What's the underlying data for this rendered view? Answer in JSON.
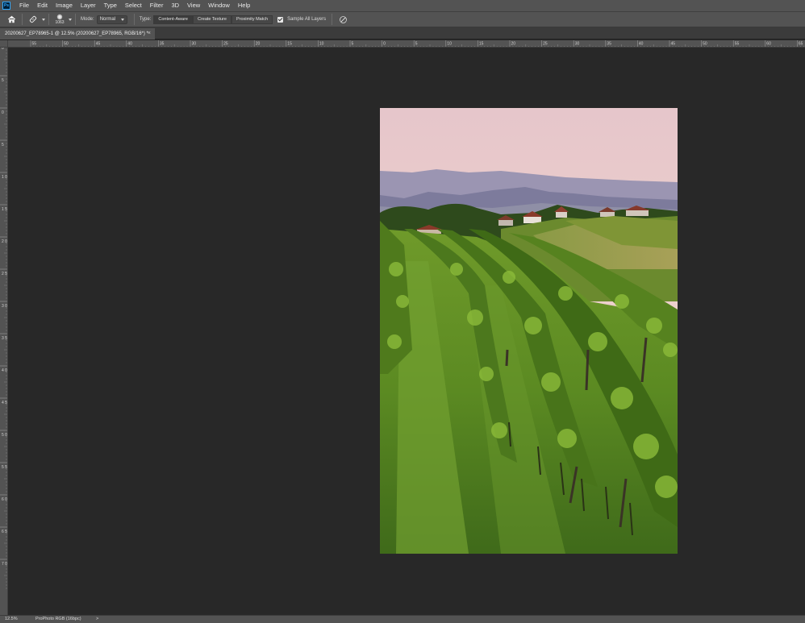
{
  "app": {
    "logo_text": "Ps"
  },
  "menu": [
    "File",
    "Edit",
    "Image",
    "Layer",
    "Type",
    "Select",
    "Filter",
    "3D",
    "View",
    "Window",
    "Help"
  ],
  "options": {
    "brush_size": "1063",
    "mode_label": "Mode:",
    "mode_value": "Normal",
    "type_label": "Type:",
    "type_options": [
      "Content-Aware",
      "Create Texture",
      "Proximity Match"
    ],
    "type_selected": "Content-Aware",
    "sample_all_layers": "Sample All Layers"
  },
  "document_tab": {
    "title": "20200627_EP78965-1 @ 12.5% (20200627_EP78965, RGB/16*) *",
    "close": "×"
  },
  "ruler_h_labels": [
    "55",
    "50",
    "45",
    "40",
    "35",
    "30",
    "25",
    "20",
    "15",
    "10",
    "5",
    "0",
    "5",
    "10",
    "15",
    "20",
    "25",
    "30",
    "35",
    "40",
    "45",
    "50",
    "55",
    "60",
    "65"
  ],
  "ruler_v_labels": [
    "0",
    "5",
    "0",
    "5",
    "1 0",
    "1 5",
    "2 0",
    "2 5",
    "3 0",
    "3 5",
    "4 0",
    "4 5",
    "5 0",
    "5 5",
    "6 0",
    "6 5",
    "7 0"
  ],
  "status": {
    "zoom": "12.5%",
    "profile": "ProPhoto RGB (16bpc)",
    "arrow": ">"
  },
  "colors": {
    "ui_panel": "#535353",
    "workspace": "#282828",
    "sky_top": "#e9ccce",
    "sky_bottom": "#f2d6c8",
    "mountains": "#8a87a8",
    "vine_green": "#5f8a25"
  }
}
